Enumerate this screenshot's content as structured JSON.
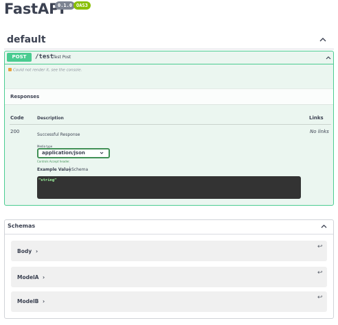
{
  "header": {
    "title": "FastAPI",
    "version_badge": "0.1.0",
    "oas_badge": "OAS3"
  },
  "tag": {
    "name": "default"
  },
  "operation": {
    "method": "POST",
    "path": "/test",
    "summary": "Test Post",
    "error_message": "Could not render it, see the console.",
    "responses_title": "Responses",
    "columns": {
      "code": "Code",
      "description": "Description",
      "links": "Links"
    },
    "response": {
      "code": "200",
      "description": "Successful Response",
      "links": "No links",
      "media_type_label": "Media type",
      "media_type": "application/json",
      "media_type_hint": "Controls Accept header.",
      "example_tab": "Example Value",
      "schema_tab": "Schema",
      "example_value": "\"string\""
    }
  },
  "schemas": {
    "title": "Schemas",
    "items": [
      {
        "name": "Body",
        "arrow": "›",
        "return": "↩"
      },
      {
        "name": "ModelA",
        "arrow": "›",
        "return": "↩"
      },
      {
        "name": "ModelB",
        "arrow": "›",
        "return": "↩"
      }
    ]
  },
  "colors": {
    "post_green": "#49cc90",
    "opblock_bg": "#ebf6f0",
    "code_bg": "#333333",
    "example_text": "#a2fca2",
    "version_badge": "#7d8492",
    "oas_badge": "#89bf04"
  },
  "icons": {
    "tag_collapse": "chevron-up-icon",
    "op_collapse": "chevron-up-icon",
    "select_caret": "chevron-down-icon",
    "schemas_collapse": "chevron-up-icon",
    "model_expand": "chevron-right-icon",
    "model_return": "return-arrow-icon",
    "error": "lock-icon"
  }
}
